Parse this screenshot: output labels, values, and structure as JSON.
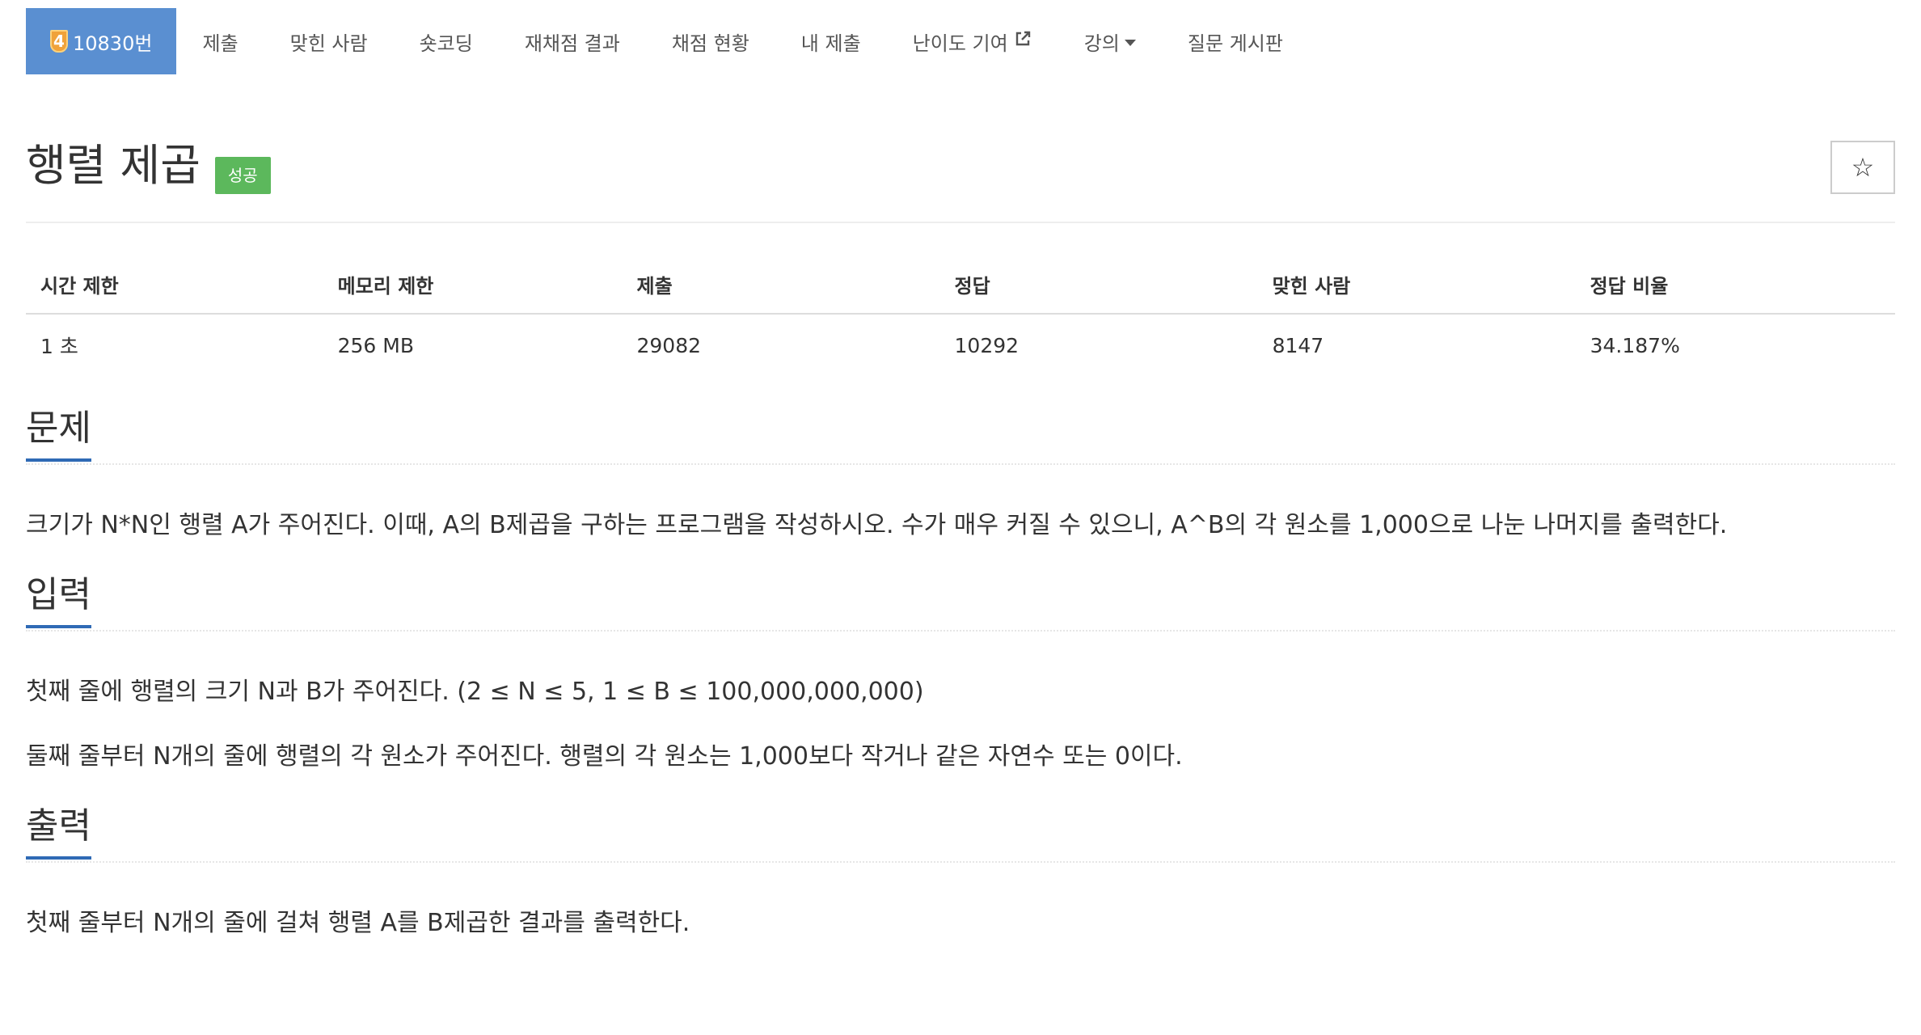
{
  "nav": {
    "items": [
      {
        "name": "problem-number-tab",
        "tier": "4",
        "label": "10830번",
        "active": true
      },
      {
        "name": "submit-tab",
        "label": "제출"
      },
      {
        "name": "solvers-tab",
        "label": "맞힌 사람"
      },
      {
        "name": "shortcoding-tab",
        "label": "숏코딩"
      },
      {
        "name": "rejudge-tab",
        "label": "재채점 결과"
      },
      {
        "name": "status-tab",
        "label": "채점 현황"
      },
      {
        "name": "my-submissions-tab",
        "label": "내 제출"
      },
      {
        "name": "difficulty-tab",
        "label": "난이도 기여",
        "icon": "external-link-icon"
      },
      {
        "name": "lecture-tab",
        "label": "강의",
        "icon": "caret-down-icon"
      },
      {
        "name": "board-tab",
        "label": "질문 게시판"
      }
    ]
  },
  "header": {
    "title": "행렬 제곱",
    "result_label": "성공",
    "star": "☆"
  },
  "stats": {
    "headers": [
      "시간 제한",
      "메모리 제한",
      "제출",
      "정답",
      "맞힌 사람",
      "정답 비율"
    ],
    "values": [
      "1 초",
      "256 MB",
      "29082",
      "10292",
      "8147",
      "34.187%"
    ]
  },
  "sections": {
    "problem": {
      "title": "문제",
      "paragraphs": [
        "크기가 N*N인 행렬 A가 주어진다. 이때, A의 B제곱을 구하는 프로그램을 작성하시오. 수가 매우 커질 수 있으니, A^B의 각 원소를 1,000으로 나눈 나머지를 출력한다."
      ]
    },
    "input": {
      "title": "입력",
      "paragraphs": [
        "첫째 줄에 행렬의 크기 N과 B가 주어진다. (2 ≤ N ≤  5, 1 ≤ B ≤ 100,000,000,000)",
        "둘째 줄부터 N개의 줄에 행렬의 각 원소가 주어진다. 행렬의 각 원소는 1,000보다 작거나 같은 자연수 또는 0이다."
      ]
    },
    "output": {
      "title": "출력",
      "paragraphs": [
        "첫째 줄부터 N개의 줄에 걸쳐 행렬 A를 B제곱한 결과를 출력한다."
      ]
    }
  },
  "colors": {
    "active_tab": "#5a8fd1",
    "success": "#5cb85c",
    "section_underline": "#2f6ab5",
    "tier_badge": "#f0a23a"
  }
}
